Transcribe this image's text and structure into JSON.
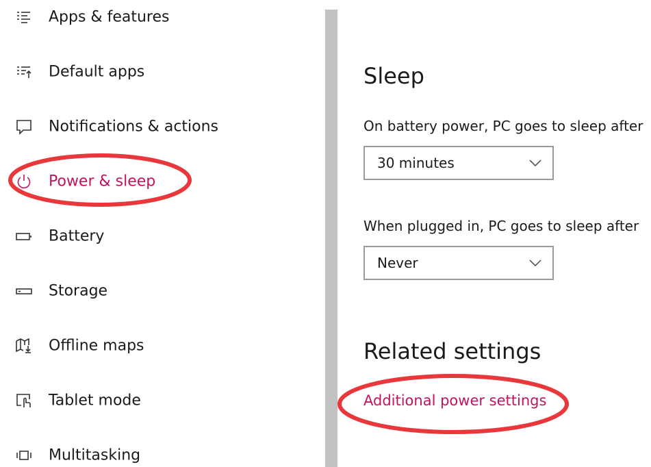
{
  "sidebar": {
    "items": [
      {
        "label": "Apps & features",
        "icon": "apps-features-icon"
      },
      {
        "label": "Default apps",
        "icon": "default-apps-icon"
      },
      {
        "label": "Notifications & actions",
        "icon": "notifications-icon"
      },
      {
        "label": "Power & sleep",
        "icon": "power-icon",
        "active": true
      },
      {
        "label": "Battery",
        "icon": "battery-icon"
      },
      {
        "label": "Storage",
        "icon": "storage-icon"
      },
      {
        "label": "Offline maps",
        "icon": "offline-maps-icon"
      },
      {
        "label": "Tablet mode",
        "icon": "tablet-mode-icon"
      },
      {
        "label": "Multitasking",
        "icon": "multitasking-icon"
      }
    ]
  },
  "sleep": {
    "title": "Sleep",
    "battery_label": "On battery power, PC goes to sleep after",
    "battery_value": "30 minutes",
    "plugged_label": "When plugged in, PC goes to sleep after",
    "plugged_value": "Never"
  },
  "related": {
    "title": "Related settings",
    "link": "Additional power settings"
  },
  "colors": {
    "accent": "#c3135f",
    "annotation": "#e8383b",
    "divider": "#c2c2c2",
    "dropdown_border": "#999999"
  }
}
